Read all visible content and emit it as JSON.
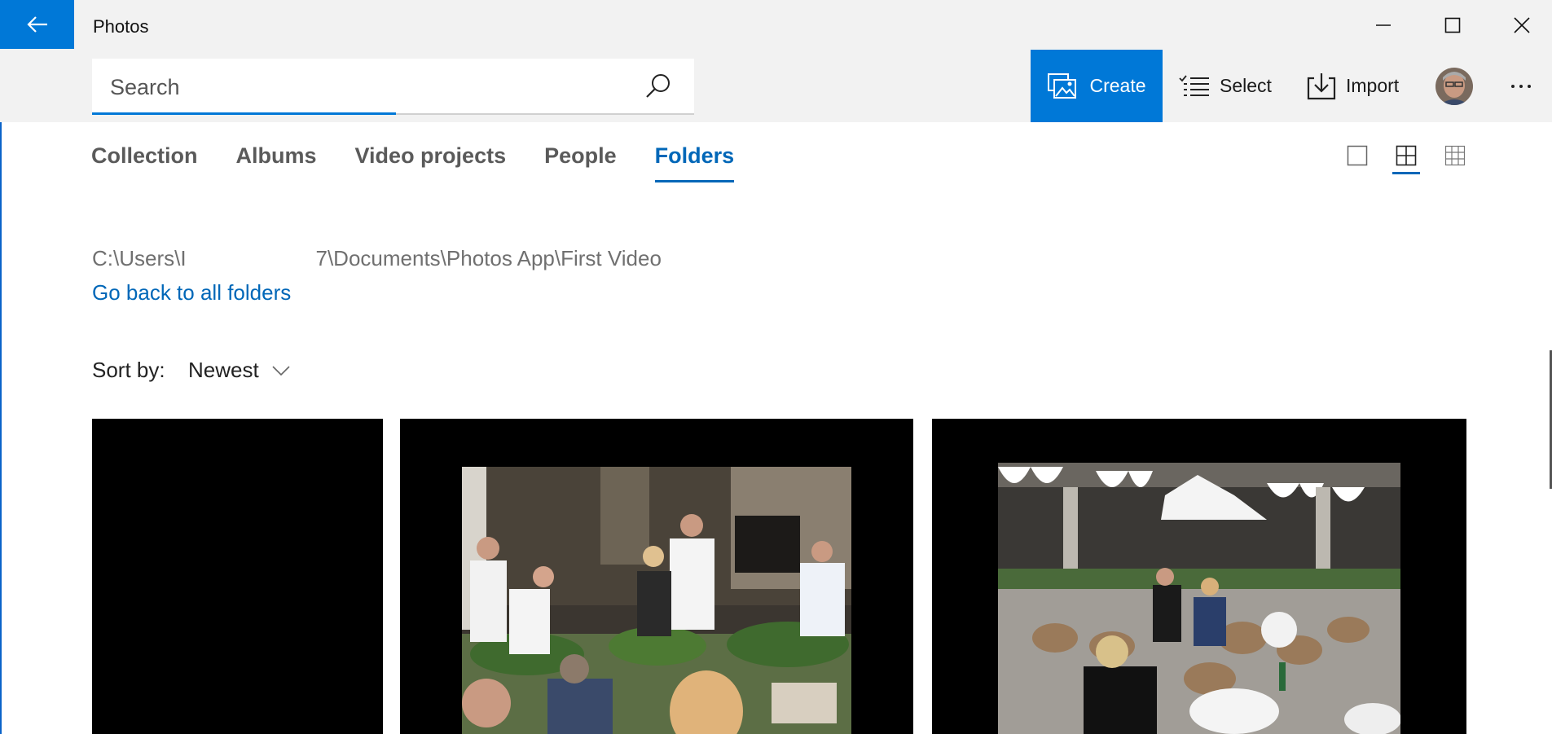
{
  "window": {
    "title": "Photos",
    "minimize_icon": "minimize-icon",
    "maximize_icon": "maximize-icon",
    "close_icon": "close-icon"
  },
  "search": {
    "placeholder": "Search",
    "value": ""
  },
  "commands": {
    "create_label": "Create",
    "select_label": "Select",
    "import_label": "Import"
  },
  "tabs": [
    {
      "label": "Collection",
      "active": false
    },
    {
      "label": "Albums",
      "active": false
    },
    {
      "label": "Video projects",
      "active": false
    },
    {
      "label": "People",
      "active": false
    },
    {
      "label": "Folders",
      "active": true
    }
  ],
  "view_sizes": [
    "large-tile-icon",
    "medium-tile-icon",
    "small-tile-icon"
  ],
  "active_view": "medium-tile-icon",
  "folder": {
    "path": "C:\\Users\\I                      7\\Documents\\Photos App\\First Video",
    "back_link": "Go back to all folders"
  },
  "sort": {
    "label": "Sort by:",
    "value": "Newest"
  },
  "colors": {
    "accent": "#0078d7",
    "link": "#0067b8",
    "topbar": "#f2f2f2"
  }
}
